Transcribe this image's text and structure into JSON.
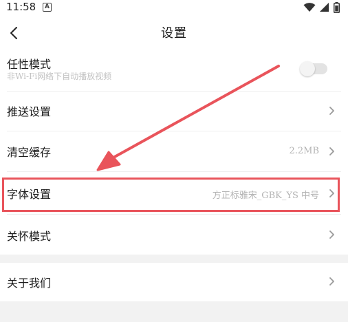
{
  "status_bar": {
    "time": "11:58",
    "notification_badge": "A"
  },
  "header": {
    "title": "设置",
    "back_icon": "chevron-left-icon"
  },
  "settings": {
    "rows": [
      {
        "label": "任性模式",
        "subtitle": "非Wi-Fi网络下自动播放视频",
        "control": "toggle",
        "toggle_on": false
      },
      {
        "label": "推送设置",
        "value": "",
        "control": "chevron"
      },
      {
        "label": "清空缓存",
        "value": "2.2MB",
        "control": "chevron"
      },
      {
        "label": "字体设置",
        "value": "方正标雅宋_GBK_YS 中号",
        "control": "chevron",
        "highlighted": true
      },
      {
        "label": "关怀模式",
        "value": "",
        "control": "chevron"
      },
      {
        "label": "关于我们",
        "value": "",
        "control": "chevron"
      }
    ]
  },
  "annotation": {
    "color": "#e9545b",
    "target": "字体设置"
  },
  "colors": {
    "text": "#1c1c1c",
    "muted": "#b4b4b4",
    "chevron": "#9a9a9a",
    "divider": "#eeeeee",
    "section_band": "#f2f2f2"
  }
}
